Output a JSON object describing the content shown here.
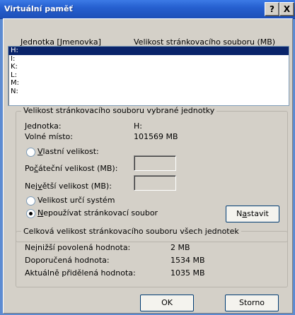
{
  "window": {
    "title": "Virtuální paměť",
    "help_label": "?",
    "close_label": "X"
  },
  "list": {
    "header_drive_pre": "",
    "header_drive_underline": "J",
    "header_drive_post": "ednotka [Jmenovka]",
    "header_size": "Velikost stránkovacího souboru (MB)",
    "rows": [
      "H:",
      "I:",
      "K:",
      "L:",
      "M:",
      "N:"
    ],
    "selected_index": 0
  },
  "selected_drive": {
    "group_title": "Velikost stránkovacího souboru vybrané jednotky",
    "drive_label": "Jednotka:",
    "drive_value": "H:",
    "free_label": "Volné místo:",
    "free_value": "101569 MB",
    "custom_pre": "",
    "custom_ul": "V",
    "custom_post": "lastní velikost:",
    "initial_pre": "Po",
    "initial_ul": "č",
    "initial_post": "áteční velikost (MB):",
    "max_pre": "Nej",
    "max_ul": "v",
    "max_post": "ětší velikost (MB):",
    "system_managed": "Velikost určí systém",
    "no_paging_pre": "",
    "no_paging_ul": "N",
    "no_paging_post": "epoužívat stránkovací soubor",
    "set_pre": "N",
    "set_ul": "a",
    "set_post": "stavit",
    "selected_option": "no_paging"
  },
  "totals": {
    "group_title": "Celková velikost stránkovacího souboru všech jednotek",
    "min_label": "Nejnižší povolená hodnota:",
    "min_value": "2 MB",
    "recommended_label": "Doporučená hodnota:",
    "recommended_value": "1534 MB",
    "current_label": "Aktuálně přidělená hodnota:",
    "current_value": "1035 MB"
  },
  "footer": {
    "ok_label": "OK",
    "cancel_label": "Storno"
  }
}
